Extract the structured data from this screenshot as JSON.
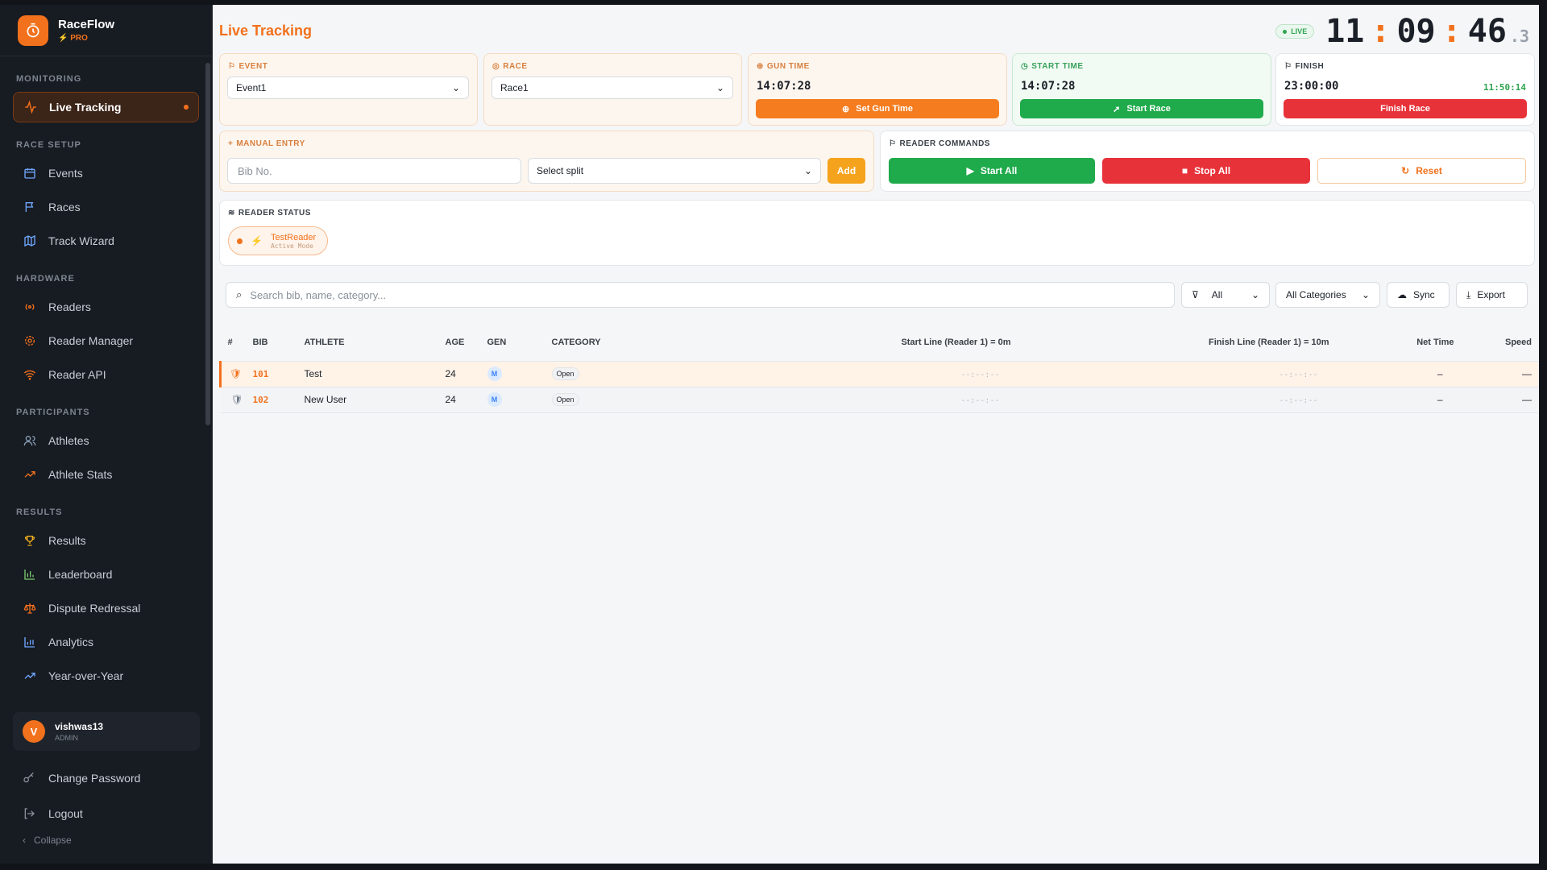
{
  "brand": {
    "name": "RaceFlow",
    "tier": "PRO"
  },
  "sidebar": {
    "sections": [
      {
        "title": "MONITORING",
        "items": [
          {
            "label": "Live Tracking",
            "icon": "activity-icon",
            "active": true
          }
        ]
      },
      {
        "title": "RACE SETUP",
        "items": [
          {
            "label": "Events",
            "icon": "calendar-icon"
          },
          {
            "label": "Races",
            "icon": "flag-icon"
          },
          {
            "label": "Track Wizard",
            "icon": "map-icon"
          }
        ]
      },
      {
        "title": "HARDWARE",
        "items": [
          {
            "label": "Readers",
            "icon": "radio-icon"
          },
          {
            "label": "Reader Manager",
            "icon": "gear-icon"
          },
          {
            "label": "Reader API",
            "icon": "wifi-icon"
          }
        ]
      },
      {
        "title": "PARTICIPANTS",
        "items": [
          {
            "label": "Athletes",
            "icon": "users-icon"
          },
          {
            "label": "Athlete Stats",
            "icon": "trending-icon"
          }
        ]
      },
      {
        "title": "RESULTS",
        "items": [
          {
            "label": "Results",
            "icon": "trophy-icon"
          },
          {
            "label": "Leaderboard",
            "icon": "bar-chart-icon"
          },
          {
            "label": "Dispute Redressal",
            "icon": "scale-icon"
          },
          {
            "label": "Analytics",
            "icon": "analytics-icon"
          },
          {
            "label": "Year-over-Year",
            "icon": "trending-icon"
          }
        ]
      }
    ],
    "user": {
      "initial": "V",
      "name": "vishwas13",
      "role": "ADMIN"
    },
    "change_password": "Change Password",
    "logout": "Logout",
    "collapse": "Collapse"
  },
  "header": {
    "title": "Live Tracking",
    "live": "LIVE",
    "clock": {
      "h": "11",
      "m": "09",
      "s": "46",
      "ms": ".3"
    }
  },
  "event": {
    "label": "EVENT",
    "value": "Event1"
  },
  "race": {
    "label": "RACE",
    "value": "Race1"
  },
  "gun": {
    "label": "GUN TIME",
    "time": "14:07:28",
    "button": "Set Gun Time"
  },
  "start": {
    "label": "START TIME",
    "time": "14:07:28",
    "button": "Start Race"
  },
  "finish": {
    "label": "FINISH",
    "time": "23:00:00",
    "elapsed": "11:50:14",
    "button": "Finish Race"
  },
  "manual": {
    "label": "MANUAL ENTRY",
    "bib_placeholder": "Bib No.",
    "split": "Select split",
    "add": "Add"
  },
  "commands": {
    "label": "READER COMMANDS",
    "start_all": "Start All",
    "stop_all": "Stop All",
    "reset": "Reset"
  },
  "reader_status": {
    "label": "READER STATUS",
    "name": "TestReader",
    "mode": "Active Mode"
  },
  "toolbar": {
    "search_placeholder": "Search bib, name, category...",
    "filter": "All",
    "categories": "All Categories",
    "sync": "Sync",
    "export": "Export"
  },
  "table": {
    "headers": [
      "#",
      "BIB",
      "ATHLETE",
      "AGE",
      "GEN",
      "CATEGORY",
      "Start Line (Reader 1) = 0m",
      "Finish Line (Reader 1) = 10m",
      "Net Time",
      "Speed"
    ],
    "rows": [
      {
        "bib": "101",
        "athlete": "Test",
        "age": "24",
        "gen": "M",
        "category": "Open",
        "start": "--:--:--",
        "finish": "--:--:--",
        "net": "–",
        "speed": "—"
      },
      {
        "bib": "102",
        "athlete": "New User",
        "age": "24",
        "gen": "M",
        "category": "Open",
        "start": "--:--:--",
        "finish": "--:--:--",
        "net": "–",
        "speed": "—"
      }
    ]
  }
}
